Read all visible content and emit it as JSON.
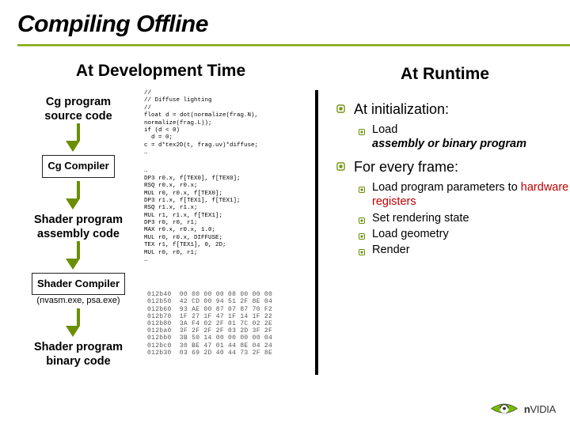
{
  "title": "Compiling Offline",
  "left": {
    "heading": "At Development Time",
    "flow": [
      {
        "label": "Cg program\nsource code",
        "framed": false
      },
      {
        "label": "Cg Compiler",
        "framed": true
      },
      {
        "label": "Shader program\nassembly code",
        "framed": false
      },
      {
        "label": "Shader Compiler",
        "framed": true,
        "caption": "(nvasm.exe, psa.exe)"
      },
      {
        "label": "Shader program\nbinary code",
        "framed": false
      }
    ],
    "code_cg": "//\n// Diffuse lighting\n//\nfloat d = dot(normalize(frag.N),\nnormalize(frag.L));\nif (d < 0)\n  d = 0;\nc = d*tex2D(t, frag.uv)*diffuse;\n…",
    "code_asm": "…\nDP3 r0.x, f[TEX0], f[TEX0];\nRSQ r0.x, r0.x;\nMUL r0, r0.x, f[TEX0];\nDP3 r1.x, f[TEX1], f[TEX1];\nRSQ r1.x, r1.x;\nMUL r1, r1.x, f[TEX1];\nDP3 r0, r0, r1;\nMAX r0.x, r0.x, 1.0;\nMUL r0, r0.x, DIFFUSE;\nTEX r1, f[TEX1], 0, 2D;\nMUL r0, r0, r1;\n…",
    "hex": "012b40  00 00 00 00 08 00 00 00\n012b50  42 CD 00 94 51 2F 8E 04\n012b60  93 AE 00 87 07 87 70 F2\n012b70  1F 27 1F 47 1F 14 1F 22\n012b80  3A F4 02 2F 01 7C 02 2E\n012ba0  3F 2F 2F 2F 03 2D 3F 2F\n012bb0  3B 50 14 00 00 00 00 04\n012bc0  30 BE 47 01 44 8E 04 24\n012b30  03 69 2D 40 44 73 2F 8E"
  },
  "right": {
    "heading": "At Runtime",
    "items": [
      {
        "label": "At initialization:",
        "sub": [
          {
            "text": "Load",
            "suffix": "assembly or binary program",
            "em_suffix": true
          }
        ]
      },
      {
        "label": "For every frame:",
        "sub": [
          {
            "text": "Load program parameters to ",
            "hw": "hardware registers"
          },
          {
            "text": "Set rendering state"
          },
          {
            "text": "Load geometry"
          },
          {
            "text": "Render"
          }
        ]
      }
    ]
  },
  "logo": {
    "brand": "nVIDIA"
  }
}
